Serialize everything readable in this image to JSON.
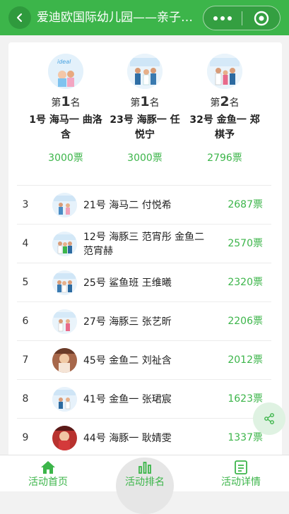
{
  "header": {
    "title": "爱迪欧国际幼儿园——亲子装·华",
    "back_icon": "chevron-left-icon",
    "more_icon": "more-dots-icon",
    "close_icon": "target-circle-icon"
  },
  "podium": [
    {
      "rank_prefix": "第",
      "rank": "1",
      "rank_suffix": "名",
      "name": "1号 海马一 曲洛含",
      "votes": "3000票"
    },
    {
      "rank_prefix": "第",
      "rank": "1",
      "rank_suffix": "名",
      "name": "23号 海豚一 任悦宁",
      "votes": "3000票"
    },
    {
      "rank_prefix": "第",
      "rank": "2",
      "rank_suffix": "名",
      "name": "32号 金鱼一 郑棋予",
      "votes": "2796票"
    }
  ],
  "ranking": [
    {
      "rank": "3",
      "name": "21号 海马二 付悦希",
      "votes": "2687票",
      "avatar": "light"
    },
    {
      "rank": "4",
      "name": "12号 海豚三 范宵彤 金鱼二 范宵赫",
      "votes": "2570票",
      "avatar": "light"
    },
    {
      "rank": "5",
      "name": "25号 鲨鱼班 王维曦",
      "votes": "2320票",
      "avatar": "light"
    },
    {
      "rank": "6",
      "name": "27号 海豚三 张艺昕",
      "votes": "2206票",
      "avatar": "light"
    },
    {
      "rank": "7",
      "name": "45号 金鱼二 刘祉含",
      "votes": "2012票",
      "avatar": "warm"
    },
    {
      "rank": "8",
      "name": "41号 金鱼一 张珺宸",
      "votes": "1623票",
      "avatar": "light"
    },
    {
      "rank": "9",
      "name": "44号 海豚一 耿婧雯",
      "votes": "1337票",
      "avatar": "red"
    }
  ],
  "share_icon": "share-icon",
  "tabs": [
    {
      "label": "活动首页",
      "icon": "home-icon"
    },
    {
      "label": "活动排名",
      "icon": "bar-chart-icon",
      "active": true
    },
    {
      "label": "活动详情",
      "icon": "detail-list-icon"
    }
  ],
  "colors": {
    "accent": "#3cb54a"
  }
}
